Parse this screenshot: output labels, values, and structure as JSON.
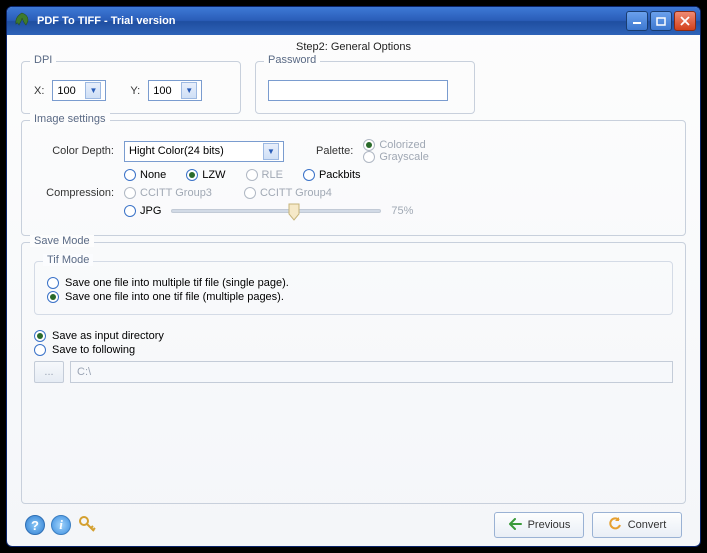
{
  "window": {
    "title": "PDF To TIFF - Trial version"
  },
  "step": "Step2: General Options",
  "dpi": {
    "legend": "DPI",
    "x_label": "X:",
    "y_label": "Y:",
    "x_value": "100",
    "y_value": "100"
  },
  "password": {
    "legend": "Password",
    "value": ""
  },
  "image_settings": {
    "legend": "Image settings",
    "color_depth_label": "Color Depth:",
    "color_depth_value": "Hight Color(24 bits)",
    "palette_label": "Palette:",
    "palette_options": {
      "colorized": "Colorized",
      "grayscale": "Grayscale"
    },
    "compression_label": "Compression:",
    "compression_options": {
      "none": "None",
      "lzw": "LZW",
      "rle": "RLE",
      "packbits": "Packbits",
      "ccitt3": "CCITT Group3",
      "ccitt4": "CCITT Group4",
      "jpg": "JPG"
    },
    "jpg_quality": "75%"
  },
  "save_mode": {
    "legend": "Save Mode",
    "tif_mode_legend": "Tif Mode",
    "tif_single": "Save one file into multiple tif file (single page).",
    "tif_multi": "Save one file into one tif file (multiple pages).",
    "save_input_dir": "Save as input directory",
    "save_following": "Save to following",
    "browse_label": "...",
    "path_value": "C:\\"
  },
  "footer": {
    "previous": "Previous",
    "convert": "Convert"
  }
}
